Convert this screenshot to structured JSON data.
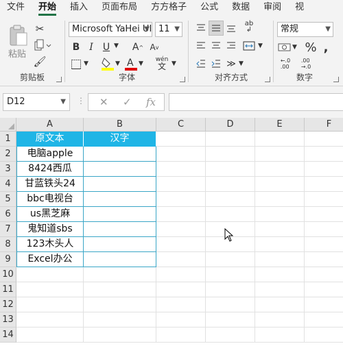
{
  "menu": {
    "tabs": [
      "文件",
      "开始",
      "插入",
      "页面布局",
      "方方格子",
      "公式",
      "数据",
      "审阅",
      "视"
    ],
    "active_index": 1
  },
  "ribbon": {
    "clipboard": {
      "paste_label": "粘贴",
      "group_label": "剪贴板"
    },
    "font": {
      "font_name": "Microsoft YaHei UI",
      "font_size": "11",
      "bold": "B",
      "italic": "I",
      "underline": "U",
      "grow": "A",
      "shrink": "A",
      "wen": "wén",
      "group_label": "字体"
    },
    "alignment": {
      "group_label": "对齐方式",
      "wrap_glyph": "ab"
    },
    "number": {
      "format": "常规",
      "percent": "%",
      "group_label": "数字",
      "inc_decimal": "←.0\n.00",
      "dec_decimal": ".00\n→.0"
    }
  },
  "formula_bar": {
    "name_box": "D12",
    "cancel": "✕",
    "enter": "✓",
    "fx": "fx",
    "value": ""
  },
  "sheet": {
    "columns": [
      "A",
      "B",
      "C",
      "D",
      "E",
      "F"
    ],
    "rows": [
      "1",
      "2",
      "3",
      "4",
      "5",
      "6",
      "7",
      "8",
      "9",
      "10",
      "11",
      "12",
      "13",
      "14"
    ],
    "headers": [
      "原文本",
      "汉字"
    ],
    "data": [
      [
        "电脑apple",
        ""
      ],
      [
        "8424西瓜",
        ""
      ],
      [
        "甘蓝铁头24",
        ""
      ],
      [
        "bbc电视台",
        ""
      ],
      [
        "us黑芝麻",
        ""
      ],
      [
        "鬼知道sbs",
        ""
      ],
      [
        "123木头人",
        ""
      ],
      [
        "Excel办公",
        ""
      ]
    ],
    "header_color": "#1fb5e6",
    "border_color": "#3aa6c7"
  }
}
